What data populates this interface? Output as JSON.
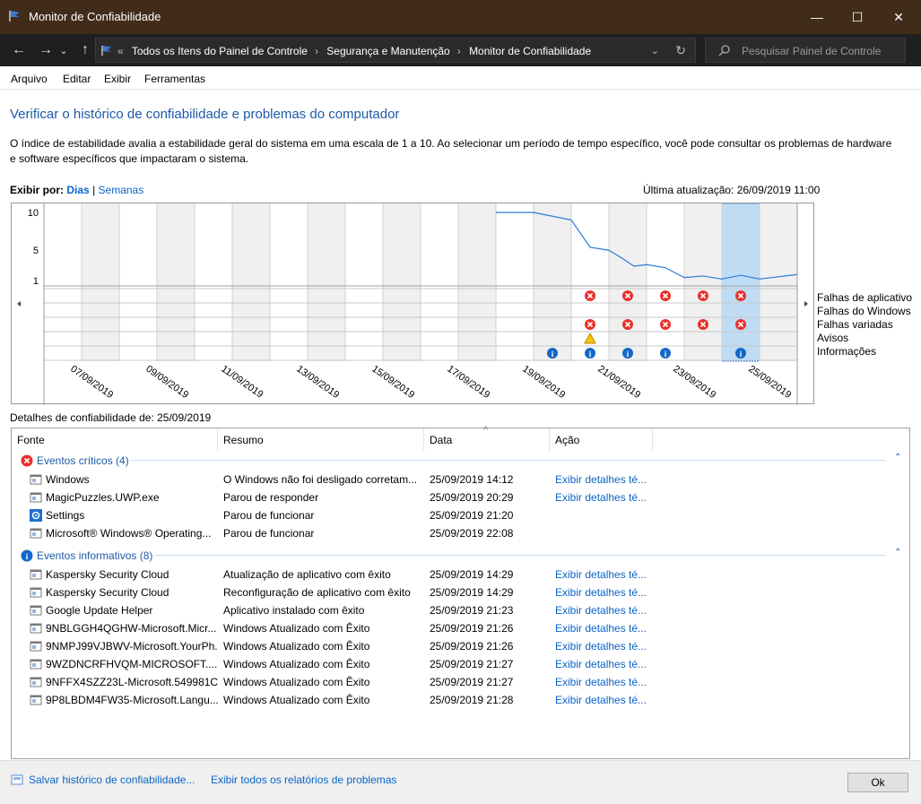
{
  "window": {
    "title": "Monitor de Confiabilidade",
    "minimize": "—",
    "maximize": "☐",
    "close": "✕"
  },
  "nav": {
    "back": "←",
    "forward": "→",
    "down": "⌄",
    "up": "↑"
  },
  "address": {
    "prefix": "«",
    "crumbs": [
      "Todos os Itens do Painel de Controle",
      "Segurança e Manutenção",
      "Monitor de Confiabilidade"
    ],
    "separator": "›",
    "dropdown": "⌄",
    "refresh": "↻"
  },
  "search": {
    "placeholder": "Pesquisar Painel de Controle"
  },
  "menu": [
    "Arquivo",
    "Editar",
    "Exibir",
    "Ferramentas"
  ],
  "heading": "Verificar o histórico de confiabilidade e problemas do computador",
  "description": "O índice de estabilidade avalia a estabilidade geral do sistema em uma escala de 1 a 10. Ao selecionar um período de tempo específico, você pode consultar os problemas de hardware e software específicos que impactaram o sistema.",
  "viewby": {
    "label": "Exibir por:",
    "days": "Dias",
    "sep": "|",
    "weeks": "Semanas"
  },
  "last_update": "Última atualização: 26/09/2019 11:00",
  "chart_data": {
    "type": "line",
    "y_ticks": [
      "10",
      "5",
      "1"
    ],
    "ylim": [
      1,
      10
    ],
    "x_labels": [
      "07/09/2019",
      "09/09/2019",
      "11/09/2019",
      "13/09/2019",
      "15/09/2019",
      "17/09/2019",
      "19/09/2019",
      "21/09/2019",
      "23/09/2019",
      "25/09/2019"
    ],
    "selected_date": "25/09/2019",
    "stability_index": [
      {
        "x": "19/09/2019",
        "y": 10.0
      },
      {
        "x": "20/09/2019",
        "y": 10.0
      },
      {
        "x": "21/09/2019",
        "y": 9.0
      },
      {
        "x": "21/09/2019",
        "y": 5.4
      },
      {
        "x": "22/09/2019",
        "y": 5.0
      },
      {
        "x": "22/09/2019",
        "y": 4.0
      },
      {
        "x": "22/09/2019",
        "y": 2.9
      },
      {
        "x": "23/09/2019",
        "y": 3.1
      },
      {
        "x": "23/09/2019",
        "y": 2.7
      },
      {
        "x": "24/09/2019",
        "y": 1.4
      },
      {
        "x": "24/09/2019",
        "y": 1.6
      },
      {
        "x": "25/09/2019",
        "y": 1.2
      },
      {
        "x": "25/09/2019",
        "y": 1.7
      },
      {
        "x": "26/09/2019",
        "y": 1.2
      },
      {
        "x": "27/09/2019",
        "y": 1.8
      }
    ],
    "event_rows": [
      "Falhas de aplicativo",
      "Falhas do Windows",
      "Falhas variadas",
      "Avisos",
      "Informações"
    ],
    "events": {
      "Falhas de aplicativo": [
        "21/09/2019",
        "22/09/2019",
        "23/09/2019",
        "24/09/2019",
        "25/09/2019"
      ],
      "Falhas variadas": [
        "21/09/2019",
        "22/09/2019",
        "23/09/2019",
        "24/09/2019",
        "25/09/2019"
      ],
      "Avisos": [
        "21/09/2019"
      ],
      "Informações": [
        "20/09/2019",
        "21/09/2019",
        "22/09/2019",
        "23/09/2019",
        "25/09/2019"
      ]
    }
  },
  "details": {
    "label": "Detalhes de confiabilidade de: 25/09/2019",
    "columns": [
      "Fonte",
      "Resumo",
      "Data",
      "Ação"
    ],
    "sort_indicator": "^",
    "groups": [
      {
        "title": "Eventos críticos (4)",
        "icon": "error-icon",
        "collapse": "⌃",
        "rows": [
          {
            "icon": "app-icon",
            "source": "Windows",
            "summary": "O Windows não foi desligado corretam...",
            "date": "25/09/2019 14:12",
            "action": "Exibir detalhes té..."
          },
          {
            "icon": "app-icon",
            "source": "MagicPuzzles.UWP.exe",
            "summary": "Parou de responder",
            "date": "25/09/2019 20:29",
            "action": "Exibir detalhes té..."
          },
          {
            "icon": "gear-icon",
            "source": "Settings",
            "summary": "Parou de funcionar",
            "date": "25/09/2019 21:20",
            "action": ""
          },
          {
            "icon": "app-icon",
            "source": "Microsoft® Windows® Operating...",
            "summary": "Parou de funcionar",
            "date": "25/09/2019 22:08",
            "action": ""
          }
        ]
      },
      {
        "title": "Eventos informativos (8)",
        "icon": "info-icon",
        "collapse": "⌃",
        "rows": [
          {
            "icon": "app-icon",
            "source": "Kaspersky Security Cloud",
            "summary": "Atualização de aplicativo com êxito",
            "date": "25/09/2019 14:29",
            "action": "Exibir detalhes té..."
          },
          {
            "icon": "app-icon",
            "source": "Kaspersky Security Cloud",
            "summary": "Reconfiguração de aplicativo com êxito",
            "date": "25/09/2019 14:29",
            "action": "Exibir detalhes té..."
          },
          {
            "icon": "app-icon",
            "source": "Google Update Helper",
            "summary": "Aplicativo instalado com êxito",
            "date": "25/09/2019 21:23",
            "action": "Exibir detalhes té..."
          },
          {
            "icon": "app-icon",
            "source": "9NBLGGH4QGHW-Microsoft.Micr...",
            "summary": "Windows Atualizado com Êxito",
            "date": "25/09/2019 21:26",
            "action": "Exibir detalhes té..."
          },
          {
            "icon": "app-icon",
            "source": "9NMPJ99VJBWV-Microsoft.YourPh...",
            "summary": "Windows Atualizado com Êxito",
            "date": "25/09/2019 21:26",
            "action": "Exibir detalhes té..."
          },
          {
            "icon": "app-icon",
            "source": "9WZDNCRFHVQM-MICROSOFT....",
            "summary": "Windows Atualizado com Êxito",
            "date": "25/09/2019 21:27",
            "action": "Exibir detalhes té..."
          },
          {
            "icon": "app-icon",
            "source": "9NFFX4SZZ23L-Microsoft.549981C...",
            "summary": "Windows Atualizado com Êxito",
            "date": "25/09/2019 21:27",
            "action": "Exibir detalhes té..."
          },
          {
            "icon": "app-icon",
            "source": "9P8LBDM4FW35-Microsoft.Langu...",
            "summary": "Windows Atualizado com Êxito",
            "date": "25/09/2019 21:28",
            "action": "Exibir detalhes té..."
          }
        ]
      }
    ]
  },
  "footer": {
    "save_link": "Salvar histórico de confiabilidade...",
    "all_reports_link": "Exibir todos os relatórios de problemas",
    "ok": "Ok"
  }
}
